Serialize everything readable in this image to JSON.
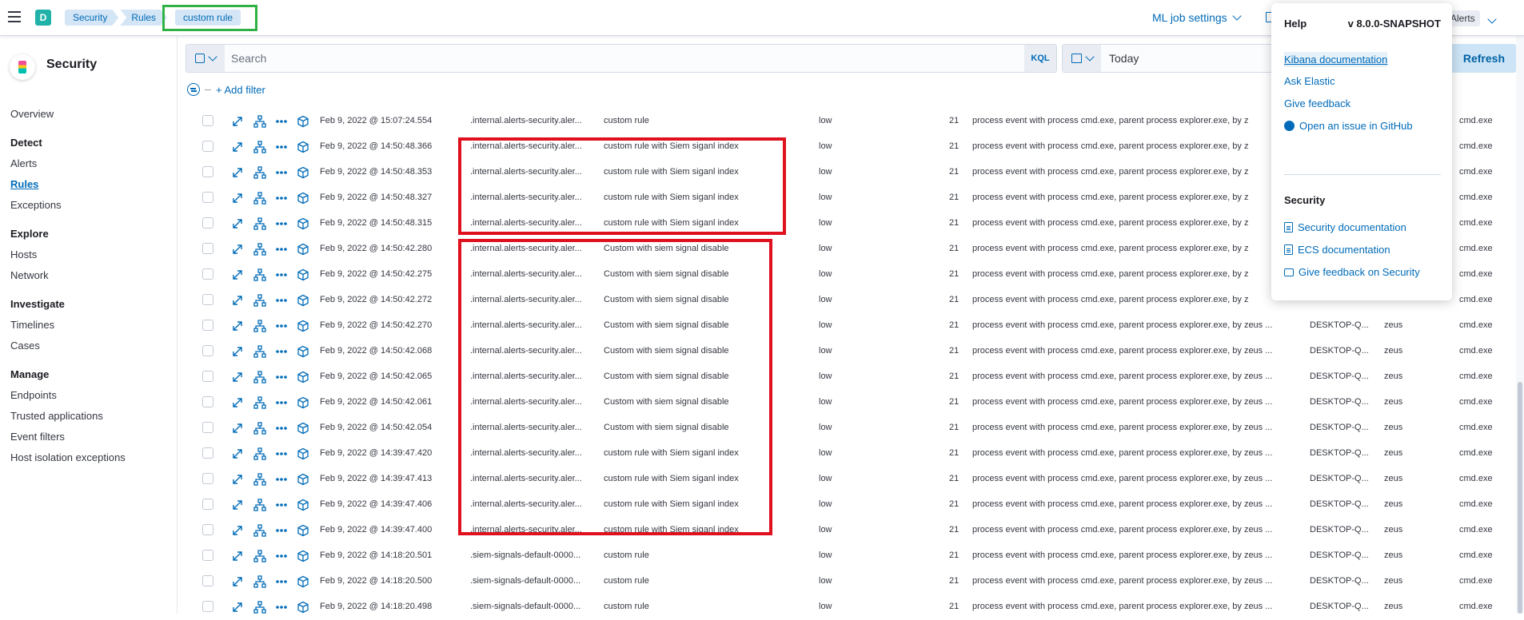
{
  "header": {
    "space_initial": "D",
    "breadcrumbs": [
      "Security",
      "Rules",
      "custom rule"
    ],
    "ml_job_settings": "ML job settings",
    "alerts_label": "Alerts"
  },
  "sidebar": {
    "title": "Security",
    "overview": "Overview",
    "groups": [
      {
        "label": "Detect",
        "items": [
          "Alerts",
          "Rules",
          "Exceptions"
        ]
      },
      {
        "label": "Explore",
        "items": [
          "Hosts",
          "Network"
        ]
      },
      {
        "label": "Investigate",
        "items": [
          "Timelines",
          "Cases"
        ]
      },
      {
        "label": "Manage",
        "items": [
          "Endpoints",
          "Trusted applications",
          "Event filters",
          "Host isolation exceptions"
        ]
      }
    ],
    "active_item": "Rules"
  },
  "search": {
    "placeholder": "Search",
    "language": "KQL",
    "date": "Today",
    "refresh_label": "Refresh",
    "add_filter": "+ Add filter"
  },
  "help_menu": {
    "title": "Help",
    "version": "v 8.0.0-SNAPSHOT",
    "links": [
      "Kibana documentation",
      "Ask Elastic",
      "Give feedback",
      "Open an issue in GitHub"
    ],
    "section_title": "Security",
    "security_links": [
      "Security documentation",
      "ECS documentation",
      "Give feedback on Security"
    ]
  },
  "table": {
    "rows": [
      {
        "timestamp": "Feb 9, 2022 @ 15:07:24.554",
        "index": ".internal.alerts-security.aler...",
        "rule": "custom rule",
        "severity": "low",
        "risk": "21",
        "reason": "process event with process cmd.exe, parent process explorer.exe, by z",
        "host": "",
        "user": "",
        "process": "cmd.exe"
      },
      {
        "timestamp": "Feb 9, 2022 @ 14:50:48.366",
        "index": ".internal.alerts-security.aler...",
        "rule": "custom rule with Siem siganl index",
        "severity": "low",
        "risk": "21",
        "reason": "process event with process cmd.exe, parent process explorer.exe, by z",
        "host": "",
        "user": "",
        "process": "cmd.exe"
      },
      {
        "timestamp": "Feb 9, 2022 @ 14:50:48.353",
        "index": ".internal.alerts-security.aler...",
        "rule": "custom rule with Siem siganl index",
        "severity": "low",
        "risk": "21",
        "reason": "process event with process cmd.exe, parent process explorer.exe, by z",
        "host": "",
        "user": "",
        "process": "cmd.exe"
      },
      {
        "timestamp": "Feb 9, 2022 @ 14:50:48.327",
        "index": ".internal.alerts-security.aler...",
        "rule": "custom rule with Siem siganl index",
        "severity": "low",
        "risk": "21",
        "reason": "process event with process cmd.exe, parent process explorer.exe, by z",
        "host": "",
        "user": "",
        "process": "cmd.exe"
      },
      {
        "timestamp": "Feb 9, 2022 @ 14:50:48.315",
        "index": ".internal.alerts-security.aler...",
        "rule": "custom rule with Siem siganl index",
        "severity": "low",
        "risk": "21",
        "reason": "process event with process cmd.exe, parent process explorer.exe, by z",
        "host": "",
        "user": "",
        "process": "cmd.exe"
      },
      {
        "timestamp": "Feb 9, 2022 @ 14:50:42.280",
        "index": ".internal.alerts-security.aler...",
        "rule": "Custom with siem signal disable",
        "severity": "low",
        "risk": "21",
        "reason": "process event with process cmd.exe, parent process explorer.exe, by z",
        "host": "",
        "user": "",
        "process": "cmd.exe"
      },
      {
        "timestamp": "Feb 9, 2022 @ 14:50:42.275",
        "index": ".internal.alerts-security.aler...",
        "rule": "Custom with siem signal disable",
        "severity": "low",
        "risk": "21",
        "reason": "process event with process cmd.exe, parent process explorer.exe, by z",
        "host": "",
        "user": "",
        "process": "cmd.exe"
      },
      {
        "timestamp": "Feb 9, 2022 @ 14:50:42.272",
        "index": ".internal.alerts-security.aler...",
        "rule": "Custom with siem signal disable",
        "severity": "low",
        "risk": "21",
        "reason": "process event with process cmd.exe, parent process explorer.exe, by z",
        "host": "",
        "user": "",
        "process": "cmd.exe"
      },
      {
        "timestamp": "Feb 9, 2022 @ 14:50:42.270",
        "index": ".internal.alerts-security.aler...",
        "rule": "Custom with siem signal disable",
        "severity": "low",
        "risk": "21",
        "reason": "process event with process cmd.exe, parent process explorer.exe, by zeus ...",
        "host": "DESKTOP-Q...",
        "user": "zeus",
        "process": "cmd.exe"
      },
      {
        "timestamp": "Feb 9, 2022 @ 14:50:42.068",
        "index": ".internal.alerts-security.aler...",
        "rule": "Custom with siem signal disable",
        "severity": "low",
        "risk": "21",
        "reason": "process event with process cmd.exe, parent process explorer.exe, by zeus ...",
        "host": "DESKTOP-Q...",
        "user": "zeus",
        "process": "cmd.exe"
      },
      {
        "timestamp": "Feb 9, 2022 @ 14:50:42.065",
        "index": ".internal.alerts-security.aler...",
        "rule": "Custom with siem signal disable",
        "severity": "low",
        "risk": "21",
        "reason": "process event with process cmd.exe, parent process explorer.exe, by zeus ...",
        "host": "DESKTOP-Q...",
        "user": "zeus",
        "process": "cmd.exe"
      },
      {
        "timestamp": "Feb 9, 2022 @ 14:50:42.061",
        "index": ".internal.alerts-security.aler...",
        "rule": "Custom with siem signal disable",
        "severity": "low",
        "risk": "21",
        "reason": "process event with process cmd.exe, parent process explorer.exe, by zeus ...",
        "host": "DESKTOP-Q...",
        "user": "zeus",
        "process": "cmd.exe"
      },
      {
        "timestamp": "Feb 9, 2022 @ 14:50:42.054",
        "index": ".internal.alerts-security.aler...",
        "rule": "Custom with siem signal disable",
        "severity": "low",
        "risk": "21",
        "reason": "process event with process cmd.exe, parent process explorer.exe, by zeus ...",
        "host": "DESKTOP-Q...",
        "user": "zeus",
        "process": "cmd.exe"
      },
      {
        "timestamp": "Feb 9, 2022 @ 14:39:47.420",
        "index": ".internal.alerts-security.aler...",
        "rule": "custom rule with Siem siganl index",
        "severity": "low",
        "risk": "21",
        "reason": "process event with process cmd.exe, parent process explorer.exe, by zeus ...",
        "host": "DESKTOP-Q...",
        "user": "zeus",
        "process": "cmd.exe"
      },
      {
        "timestamp": "Feb 9, 2022 @ 14:39:47.413",
        "index": ".internal.alerts-security.aler...",
        "rule": "custom rule with Siem siganl index",
        "severity": "low",
        "risk": "21",
        "reason": "process event with process cmd.exe, parent process explorer.exe, by zeus ...",
        "host": "DESKTOP-Q...",
        "user": "zeus",
        "process": "cmd.exe"
      },
      {
        "timestamp": "Feb 9, 2022 @ 14:39:47.406",
        "index": ".internal.alerts-security.aler...",
        "rule": "custom rule with Siem siganl index",
        "severity": "low",
        "risk": "21",
        "reason": "process event with process cmd.exe, parent process explorer.exe, by zeus ...",
        "host": "DESKTOP-Q...",
        "user": "zeus",
        "process": "cmd.exe"
      },
      {
        "timestamp": "Feb 9, 2022 @ 14:39:47.400",
        "index": ".internal.alerts-security.aler...",
        "rule": "custom rule with Siem siganl index",
        "severity": "low",
        "risk": "21",
        "reason": "process event with process cmd.exe, parent process explorer.exe, by zeus ...",
        "host": "DESKTOP-Q...",
        "user": "zeus",
        "process": "cmd.exe"
      },
      {
        "timestamp": "Feb 9, 2022 @ 14:18:20.501",
        "index": ".siem-signals-default-0000...",
        "rule": "custom rule",
        "severity": "low",
        "risk": "21",
        "reason": "process event with process cmd.exe, parent process explorer.exe, by zeus ...",
        "host": "DESKTOP-Q...",
        "user": "zeus",
        "process": "cmd.exe"
      },
      {
        "timestamp": "Feb 9, 2022 @ 14:18:20.500",
        "index": ".siem-signals-default-0000...",
        "rule": "custom rule",
        "severity": "low",
        "risk": "21",
        "reason": "process event with process cmd.exe, parent process explorer.exe, by zeus ...",
        "host": "DESKTOP-Q...",
        "user": "zeus",
        "process": "cmd.exe"
      },
      {
        "timestamp": "Feb 9, 2022 @ 14:18:20.498",
        "index": ".siem-signals-default-0000...",
        "rule": "custom rule",
        "severity": "low",
        "risk": "21",
        "reason": "process event with process cmd.exe, parent process explorer.exe, by zeus ...",
        "host": "DESKTOP-Q...",
        "user": "zeus",
        "process": "cmd.exe"
      }
    ]
  },
  "colors": {
    "link": "#006bb8",
    "highlight_red": "#e0111f",
    "highlight_green": "#2fb143",
    "space_badge": "#20b2a8"
  }
}
